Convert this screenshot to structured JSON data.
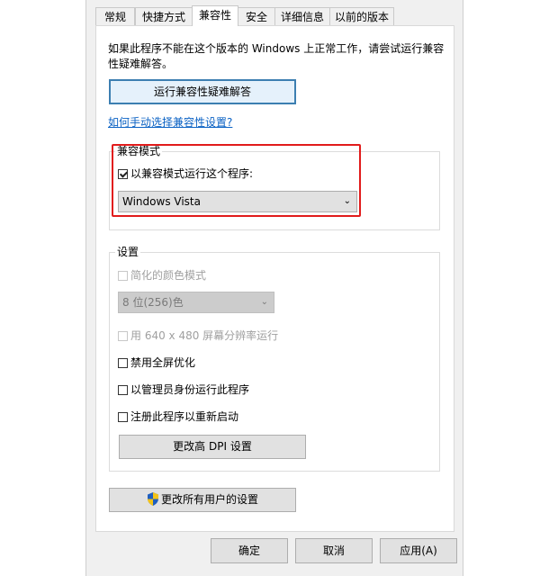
{
  "tabs": [
    {
      "label": "常规"
    },
    {
      "label": "快捷方式"
    },
    {
      "label": "兼容性"
    },
    {
      "label": "安全"
    },
    {
      "label": "详细信息"
    },
    {
      "label": "以前的版本"
    }
  ],
  "description": "如果此程序不能在这个版本的 Windows 上正常工作，请尝试运行兼容性疑难解答。",
  "troubleshoot_button": "运行兼容性疑难解答",
  "manual_link": "如何手动选择兼容性设置?",
  "compat_mode": {
    "legend": "兼容模式",
    "checkbox_label": "以兼容模式运行这个程序:",
    "checked": true,
    "selected_os": "Windows Vista",
    "highlight_color": "#e11b1b"
  },
  "settings": {
    "legend": "设置",
    "reduced_color_label": "简化的颜色模式",
    "color_depth_value": "8 位(256)色",
    "run_640_label": "用 640 x 480 屏幕分辨率运行",
    "disable_fullscreen_label": "禁用全屏优化",
    "run_as_admin_label": "以管理员身份运行此程序",
    "register_restart_label": "注册此程序以重新启动",
    "dpi_button": "更改高 DPI 设置"
  },
  "all_users_button": "更改所有用户的设置",
  "footer": {
    "ok": "确定",
    "cancel": "取消",
    "apply": "应用(A)"
  }
}
